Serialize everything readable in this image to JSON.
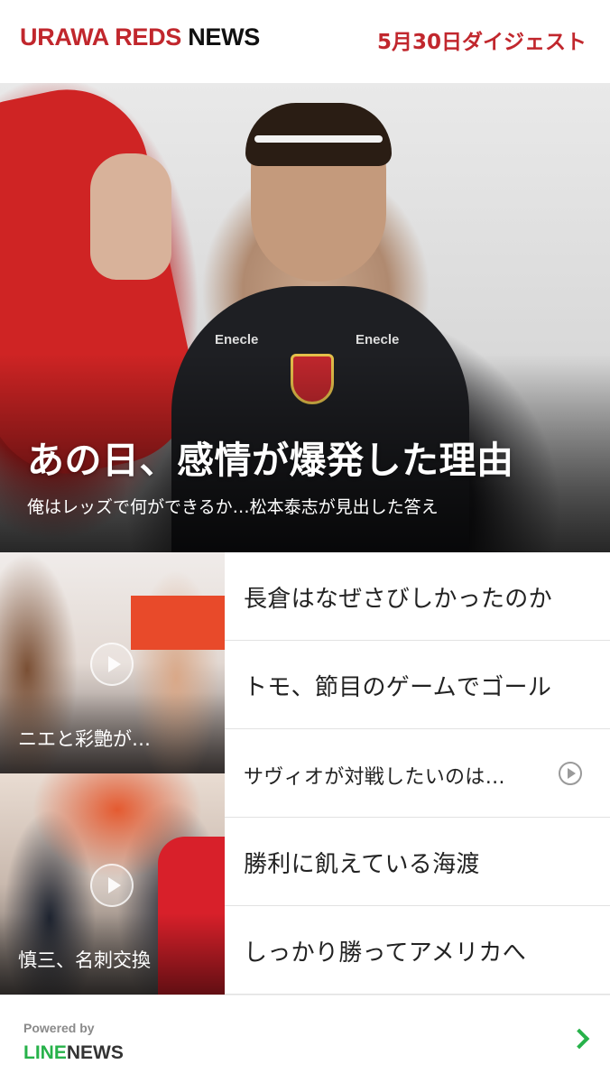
{
  "header": {
    "brand_red": "URAWA REDS",
    "brand_black": "NEWS",
    "digest_date": "5月30日ダイジェスト"
  },
  "hero": {
    "title": "あの日、感情が爆発した理由",
    "subtitle": "俺はレッズで何ができるか…松本泰志が見出した答え",
    "sponsor_left": "Enecle",
    "sponsor_right": "Enecle"
  },
  "thumbnails": [
    {
      "caption": "ニエと彩艶が…",
      "has_video": true
    },
    {
      "caption": "慎三、名刺交換",
      "has_video": true
    }
  ],
  "headlines": [
    {
      "label": "長倉はなぜさびしかったのか",
      "has_video": false
    },
    {
      "label": "トモ、節目のゲームでゴール",
      "has_video": false
    },
    {
      "label": "サヴィオが対戦したいのは…",
      "has_video": true
    },
    {
      "label": "勝利に飢えている海渡",
      "has_video": false
    },
    {
      "label": "しっかり勝ってアメリカへ",
      "has_video": false
    }
  ],
  "footer": {
    "powered_by": "Powered by",
    "logo_line": "LINE",
    "logo_news": "NEWS"
  },
  "colors": {
    "brand_red": "#c1272d",
    "line_green": "#27b24a"
  },
  "icons": {
    "play": "play-circle-icon",
    "next": "chevron-right-icon"
  }
}
